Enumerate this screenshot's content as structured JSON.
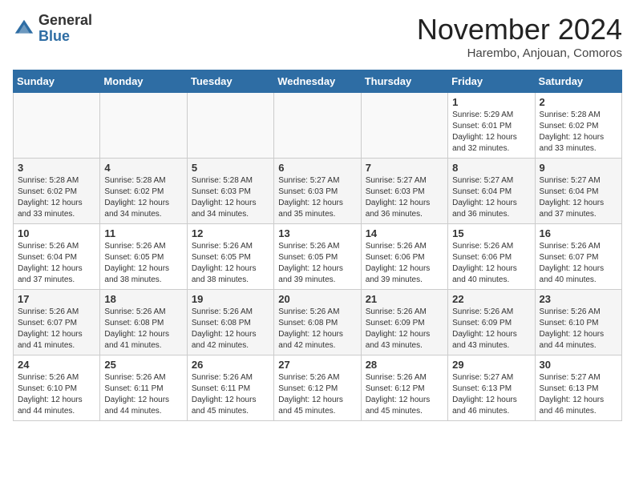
{
  "header": {
    "logo": {
      "general": "General",
      "blue": "Blue"
    },
    "title": "November 2024",
    "location": "Harembo, Anjouan, Comoros"
  },
  "calendar": {
    "weekdays": [
      "Sunday",
      "Monday",
      "Tuesday",
      "Wednesday",
      "Thursday",
      "Friday",
      "Saturday"
    ],
    "weeks": [
      [
        {
          "day": "",
          "info": ""
        },
        {
          "day": "",
          "info": ""
        },
        {
          "day": "",
          "info": ""
        },
        {
          "day": "",
          "info": ""
        },
        {
          "day": "",
          "info": ""
        },
        {
          "day": "1",
          "info": "Sunrise: 5:29 AM\nSunset: 6:01 PM\nDaylight: 12 hours\nand 32 minutes."
        },
        {
          "day": "2",
          "info": "Sunrise: 5:28 AM\nSunset: 6:02 PM\nDaylight: 12 hours\nand 33 minutes."
        }
      ],
      [
        {
          "day": "3",
          "info": "Sunrise: 5:28 AM\nSunset: 6:02 PM\nDaylight: 12 hours\nand 33 minutes."
        },
        {
          "day": "4",
          "info": "Sunrise: 5:28 AM\nSunset: 6:02 PM\nDaylight: 12 hours\nand 34 minutes."
        },
        {
          "day": "5",
          "info": "Sunrise: 5:28 AM\nSunset: 6:03 PM\nDaylight: 12 hours\nand 34 minutes."
        },
        {
          "day": "6",
          "info": "Sunrise: 5:27 AM\nSunset: 6:03 PM\nDaylight: 12 hours\nand 35 minutes."
        },
        {
          "day": "7",
          "info": "Sunrise: 5:27 AM\nSunset: 6:03 PM\nDaylight: 12 hours\nand 36 minutes."
        },
        {
          "day": "8",
          "info": "Sunrise: 5:27 AM\nSunset: 6:04 PM\nDaylight: 12 hours\nand 36 minutes."
        },
        {
          "day": "9",
          "info": "Sunrise: 5:27 AM\nSunset: 6:04 PM\nDaylight: 12 hours\nand 37 minutes."
        }
      ],
      [
        {
          "day": "10",
          "info": "Sunrise: 5:26 AM\nSunset: 6:04 PM\nDaylight: 12 hours\nand 37 minutes."
        },
        {
          "day": "11",
          "info": "Sunrise: 5:26 AM\nSunset: 6:05 PM\nDaylight: 12 hours\nand 38 minutes."
        },
        {
          "day": "12",
          "info": "Sunrise: 5:26 AM\nSunset: 6:05 PM\nDaylight: 12 hours\nand 38 minutes."
        },
        {
          "day": "13",
          "info": "Sunrise: 5:26 AM\nSunset: 6:05 PM\nDaylight: 12 hours\nand 39 minutes."
        },
        {
          "day": "14",
          "info": "Sunrise: 5:26 AM\nSunset: 6:06 PM\nDaylight: 12 hours\nand 39 minutes."
        },
        {
          "day": "15",
          "info": "Sunrise: 5:26 AM\nSunset: 6:06 PM\nDaylight: 12 hours\nand 40 minutes."
        },
        {
          "day": "16",
          "info": "Sunrise: 5:26 AM\nSunset: 6:07 PM\nDaylight: 12 hours\nand 40 minutes."
        }
      ],
      [
        {
          "day": "17",
          "info": "Sunrise: 5:26 AM\nSunset: 6:07 PM\nDaylight: 12 hours\nand 41 minutes."
        },
        {
          "day": "18",
          "info": "Sunrise: 5:26 AM\nSunset: 6:08 PM\nDaylight: 12 hours\nand 41 minutes."
        },
        {
          "day": "19",
          "info": "Sunrise: 5:26 AM\nSunset: 6:08 PM\nDaylight: 12 hours\nand 42 minutes."
        },
        {
          "day": "20",
          "info": "Sunrise: 5:26 AM\nSunset: 6:08 PM\nDaylight: 12 hours\nand 42 minutes."
        },
        {
          "day": "21",
          "info": "Sunrise: 5:26 AM\nSunset: 6:09 PM\nDaylight: 12 hours\nand 43 minutes."
        },
        {
          "day": "22",
          "info": "Sunrise: 5:26 AM\nSunset: 6:09 PM\nDaylight: 12 hours\nand 43 minutes."
        },
        {
          "day": "23",
          "info": "Sunrise: 5:26 AM\nSunset: 6:10 PM\nDaylight: 12 hours\nand 44 minutes."
        }
      ],
      [
        {
          "day": "24",
          "info": "Sunrise: 5:26 AM\nSunset: 6:10 PM\nDaylight: 12 hours\nand 44 minutes."
        },
        {
          "day": "25",
          "info": "Sunrise: 5:26 AM\nSunset: 6:11 PM\nDaylight: 12 hours\nand 44 minutes."
        },
        {
          "day": "26",
          "info": "Sunrise: 5:26 AM\nSunset: 6:11 PM\nDaylight: 12 hours\nand 45 minutes."
        },
        {
          "day": "27",
          "info": "Sunrise: 5:26 AM\nSunset: 6:12 PM\nDaylight: 12 hours\nand 45 minutes."
        },
        {
          "day": "28",
          "info": "Sunrise: 5:26 AM\nSunset: 6:12 PM\nDaylight: 12 hours\nand 45 minutes."
        },
        {
          "day": "29",
          "info": "Sunrise: 5:27 AM\nSunset: 6:13 PM\nDaylight: 12 hours\nand 46 minutes."
        },
        {
          "day": "30",
          "info": "Sunrise: 5:27 AM\nSunset: 6:13 PM\nDaylight: 12 hours\nand 46 minutes."
        }
      ]
    ]
  }
}
